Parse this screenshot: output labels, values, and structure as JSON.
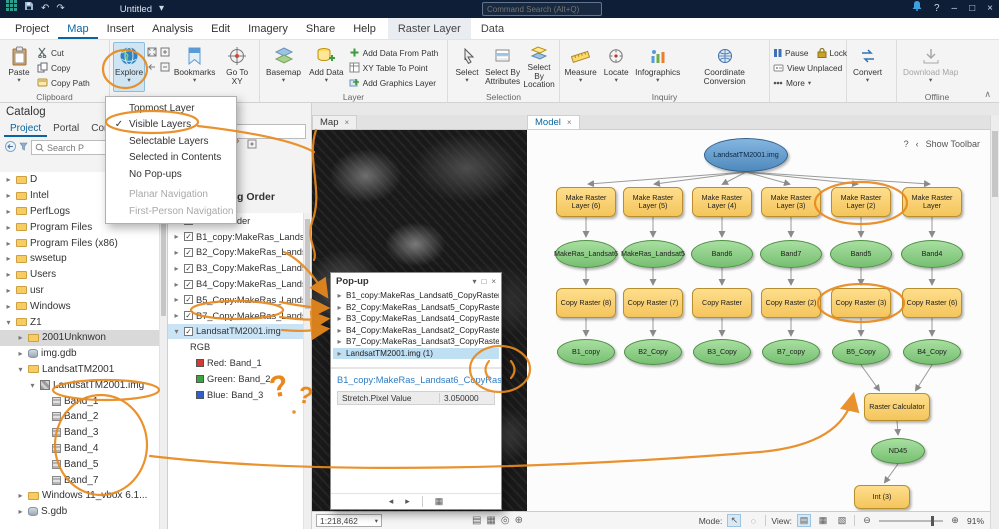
{
  "icons": {
    "undo": "↶",
    "redo": "↷",
    "caret": "▾",
    "collapse": "∧",
    "help": "?",
    "minimize": "–",
    "maximize": "□",
    "close": "×",
    "check": "✓",
    "collapsed": "▸",
    "expanded": "▾",
    "mode_pointer": "↖",
    "mode_lasso": "◌",
    "view_a": "▤",
    "view_b": "▦",
    "view_c": "▧",
    "zoom_in": "⊕",
    "zoom_out": "⊖",
    "prev": "◂",
    "next": "▸",
    "chevron_left": "‹",
    "status_a": "▤",
    "status_b": "▦",
    "status_c": "◎",
    "status_d": "⊕"
  },
  "titlebar": {
    "title": "Untitled",
    "search_placeholder": "Command Search (Alt+Q)"
  },
  "menubar": {
    "tabs": [
      "Project",
      "Map",
      "Insert",
      "Analysis",
      "Edit",
      "Imagery",
      "Share",
      "Help"
    ],
    "contextual_tabs": [
      "Raster Layer",
      "Data"
    ]
  },
  "ribbon": {
    "clipboard": {
      "group_label": "Clipboard",
      "paste": "Paste",
      "cut": "Cut",
      "copy": "Copy",
      "copy_path": "Copy Path"
    },
    "navigate": {
      "explore": "Explore",
      "bookmarks": "Bookmarks",
      "go_to_xy": "Go To XY"
    },
    "layer": {
      "group_label": "Layer",
      "basemap": "Basemap",
      "add_data": "Add Data",
      "add_data_from_path": "Add Data From Path",
      "xy_table_to_point": "XY Table To Point",
      "add_graphics_layer": "Add Graphics Layer"
    },
    "selection": {
      "group_label": "Selection",
      "select": "Select",
      "select_by_attributes": "Select By Attributes",
      "select_by_location": "Select By Location"
    },
    "inquiry": {
      "group_label": "Inquiry",
      "measure": "Measure",
      "locate": "Locate",
      "infographics": "Infographics",
      "coordinate_conversion": "Coordinate Conversion"
    },
    "labeling": {
      "pause": "Pause",
      "lock": "Lock",
      "view_unplaced": "View Unplaced",
      "more": "More"
    },
    "convert_label": "Convert",
    "offline": {
      "group_label": "Offline",
      "download_map": "Download Map"
    }
  },
  "explore_menu": {
    "items": [
      "Topmost Layer",
      "Visible Layers",
      "Selectable Layers",
      "Selected in Contents",
      "No Pop-ups",
      "Planar Navigation",
      "First-Person Navigation"
    ],
    "checked_item": "Visible Layers"
  },
  "catalog": {
    "title": "Catalog",
    "tabs": [
      "Project",
      "Portal",
      "Computer"
    ],
    "search_placeholder": "Search P",
    "tree": [
      {
        "label": "D"
      },
      {
        "label": "Intel"
      },
      {
        "label": "PerfLogs"
      },
      {
        "label": "Program Files"
      },
      {
        "label": "Program Files (x86)"
      },
      {
        "label": "swsetup"
      },
      {
        "label": "Users"
      },
      {
        "label": "usr"
      },
      {
        "label": "Windows"
      },
      {
        "label": "Z1"
      },
      {
        "label": "2001Unknwon"
      },
      {
        "label": "img.gdb"
      },
      {
        "label": "LandsatTM2001"
      },
      {
        "label": "LandsatTM2001.img"
      },
      {
        "label": "Band_1"
      },
      {
        "label": "Band_2"
      },
      {
        "label": "Band_3"
      },
      {
        "label": "Band_4"
      },
      {
        "label": "Band_5"
      },
      {
        "label": "Band_7"
      },
      {
        "label": "Windows 11_vbox 6.1..."
      },
      {
        "label": "S.gdb"
      }
    ]
  },
  "contents": {
    "search_placeholder": "Search",
    "header": "Drawing Order",
    "layers": [
      {
        "label": "ModelBuilder"
      },
      {
        "label": "B1_copy:MakeRas_Landsa..."
      },
      {
        "label": "B2_Copy:MakeRas_Lands..."
      },
      {
        "label": "B3_Copy:MakeRas_Lands..."
      },
      {
        "label": "B4_Copy:MakeRas_Lands..."
      },
      {
        "label": "B5_Copy:MakeRas_Lands..."
      },
      {
        "label": "B7_Copy:MakeRas_Landsa..."
      },
      {
        "label": "LandsatTM2001.img"
      }
    ],
    "rgb_label": "RGB",
    "channels": [
      {
        "name": "Red:",
        "band": "Band_1",
        "color": "#d63a2f"
      },
      {
        "name": "Green:",
        "band": "Band_2",
        "color": "#3aa63a"
      },
      {
        "name": "Blue:",
        "band": "Band_3",
        "color": "#2e5fd0"
      }
    ]
  },
  "map_view": {
    "tab": "Map",
    "scale": "1:218,462"
  },
  "popup": {
    "title": "Pop-up",
    "items": [
      "B1_copy:MakeRas_Landsat6_CopyRaster (1)",
      "B2_Copy:MakeRas_Landsat5_CopyRaster (1)",
      "B3_Copy:MakeRas_Landsat4_CopyRaster (1)",
      "B4_Copy:MakeRas_Landsat2_CopyRaster (1)",
      "B7_Copy:MakeRas_Landsat3_CopyRaster (1)",
      "LandsatTM2001.img (1)"
    ],
    "detail_title": "B1_copy:MakeRas_Landsat6_CopyRas...",
    "field_name": "Stretch.Pixel Value",
    "field_value": "3.050000"
  },
  "model_view": {
    "tab": "Model",
    "show_toolbar": "Show Toolbar",
    "input_node": "LandsatTM2001.img",
    "tool_row": [
      "Make Raster Layer (6)",
      "Make Raster Layer (5)",
      "Make Raster Layer (4)",
      "Make Raster Layer (3)",
      "Make Raster Layer (2)",
      "Make Raster Layer"
    ],
    "band_row": [
      "MakeRas_Landsat6",
      "MakeRas_Landsat5",
      "Band6",
      "Band7",
      "Band5",
      "Band4"
    ],
    "copy_row": [
      "Copy Raster (8)",
      "Copy Raster (7)",
      "Copy Raster",
      "Copy Raster (2)",
      "Copy Raster (3)",
      "Copy Raster (6)"
    ],
    "output_row": [
      "B1_copy",
      "B2_Copy",
      "B3_Copy",
      "B7_copy",
      "B5_Copy",
      "B4_Copy"
    ],
    "raster_calculator": "Raster Calculator",
    "nd45": "ND45",
    "int_node": "Int (3)",
    "status": {
      "mode_label": "Mode:",
      "view_label": "View:",
      "zoom": "91%"
    }
  },
  "colors": {
    "annotation_orange": "#e8891d",
    "selection_blue": "#cbe4f5",
    "tool_yellow": "#f9cf6a",
    "data_green": "#8fd08b",
    "input_blue": "#5f9ed6",
    "accent_blue": "#0a64a0",
    "titlebar_bg": "#0d1e36"
  }
}
